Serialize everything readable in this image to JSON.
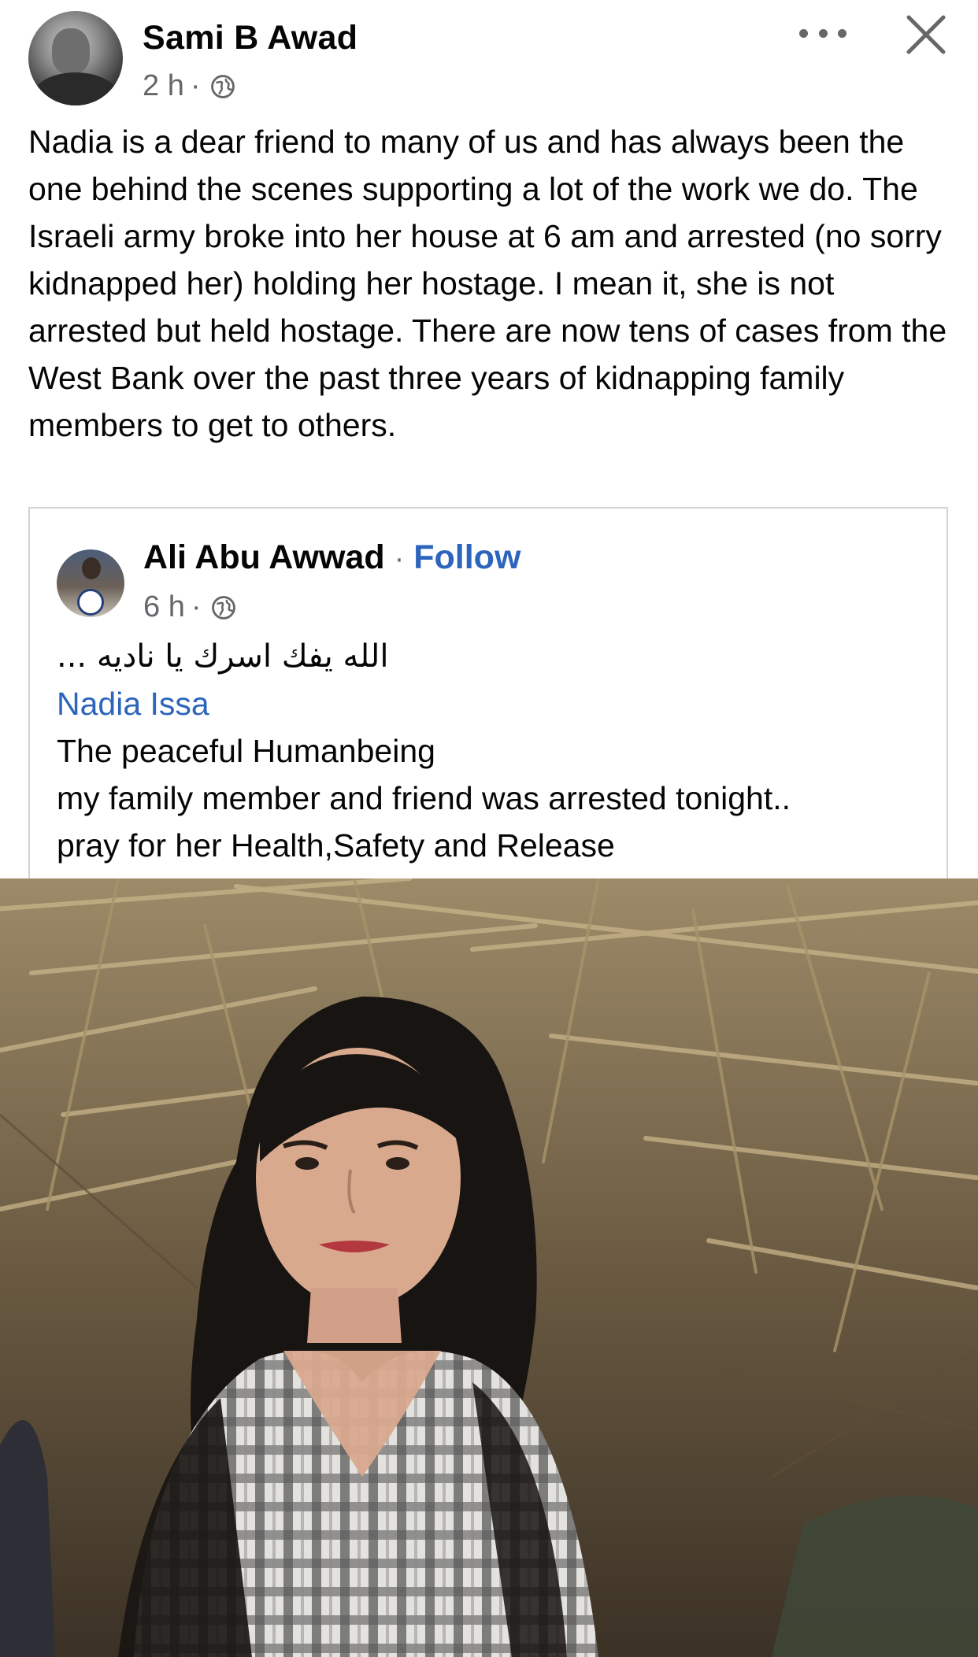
{
  "post": {
    "author": "Sami B Awad",
    "time": "2 h",
    "dot": "·",
    "privacy_icon": "globe-icon",
    "more_icon": "more-horizontal-icon",
    "close_icon": "close-icon",
    "text": "Nadia is a dear friend to many of us and has always been the one behind the scenes supporting a lot of the work we do. The Israeli army broke into her house at 6 am and arrested (no sorry kidnapped her) holding her hostage. I mean it, she is not arrested but held hostage. There are now tens of cases from the West Bank over the past three years of kidnapping family members to get to others."
  },
  "shared": {
    "author": "Ali Abu Awwad",
    "separator": "·",
    "follow_label": "Follow",
    "time": "6 h",
    "dot": "·",
    "arabic_text": "الله يفك اسرك يا ناديه ...",
    "mention": "Nadia Issa",
    "lines": [
      "The peaceful Humanbeing",
      "my family member and friend was arrested tonight..",
      "pray for her Health,Safety and Release"
    ]
  },
  "colors": {
    "text": "#050505",
    "meta": "#65676b",
    "link": "#2d64bc",
    "border": "#d3d3d3"
  }
}
